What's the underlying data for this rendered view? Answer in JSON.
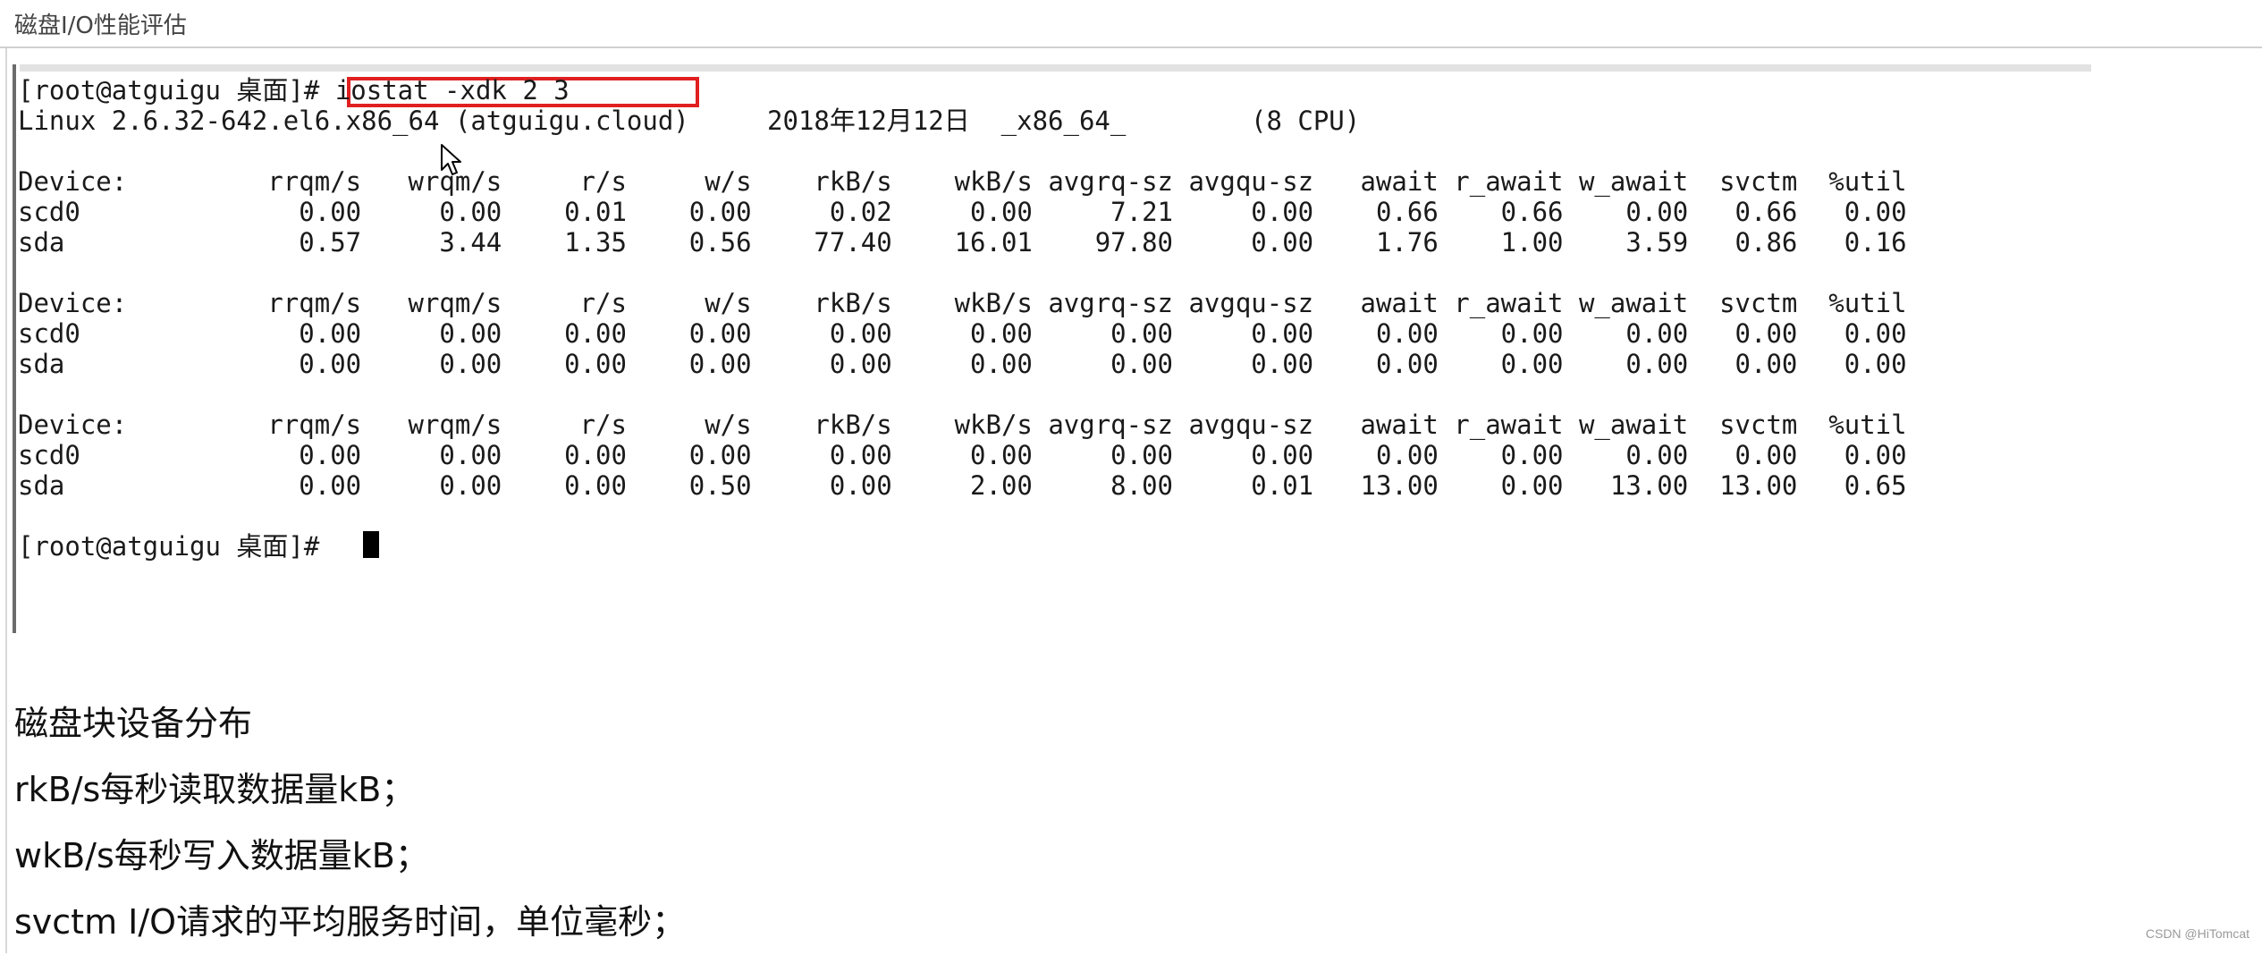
{
  "header": {
    "title": "磁盘I/O性能评估"
  },
  "terminal": {
    "prompt_line_prefix": "[root@atguigu 桌面]# ",
    "command": "iostat -xdk 2 3",
    "sys_line": "Linux 2.6.32-642.el6.x86_64 (atguigu.cloud)     2018年12月12日  _x86_64_        (8 CPU)",
    "blocks": [
      {
        "header": "Device:         rrqm/s   wrqm/s     r/s     w/s    rkB/s    wkB/s avgrq-sz avgqu-sz   await r_await w_await  svctm  %util",
        "rows": [
          "scd0              0.00     0.00    0.01    0.00     0.02     0.00     7.21     0.00    0.66    0.66    0.00   0.66   0.00",
          "sda               0.57     3.44    1.35    0.56    77.40    16.01    97.80     0.00    1.76    1.00    3.59   0.86   0.16"
        ]
      },
      {
        "header": "Device:         rrqm/s   wrqm/s     r/s     w/s    rkB/s    wkB/s avgrq-sz avgqu-sz   await r_await w_await  svctm  %util",
        "rows": [
          "scd0              0.00     0.00    0.00    0.00     0.00     0.00     0.00     0.00    0.00    0.00    0.00   0.00   0.00",
          "sda               0.00     0.00    0.00    0.00     0.00     0.00     0.00     0.00    0.00    0.00    0.00   0.00   0.00"
        ]
      },
      {
        "header": "Device:         rrqm/s   wrqm/s     r/s     w/s    rkB/s    wkB/s avgrq-sz avgqu-sz   await r_await w_await  svctm  %util",
        "rows": [
          "scd0              0.00     0.00    0.00    0.00     0.00     0.00     0.00     0.00    0.00    0.00    0.00   0.00   0.00",
          "sda               0.00     0.00    0.00    0.50     0.00     2.00     8.00     0.01   13.00    0.00   13.00  13.00   0.65"
        ]
      }
    ],
    "final_prompt": "[root@atguigu 桌面]# "
  },
  "notes": [
    "磁盘块设备分布",
    "rkB/s每秒读取数据量kB；",
    "wkB/s每秒写入数据量kB；",
    "svctm I/O请求的平均服务时间，单位毫秒；"
  ],
  "watermark": "CSDN @HiTomcat",
  "colors": {
    "highlight_box": "#e02020",
    "terminal_bar": "#6b6b6b"
  }
}
